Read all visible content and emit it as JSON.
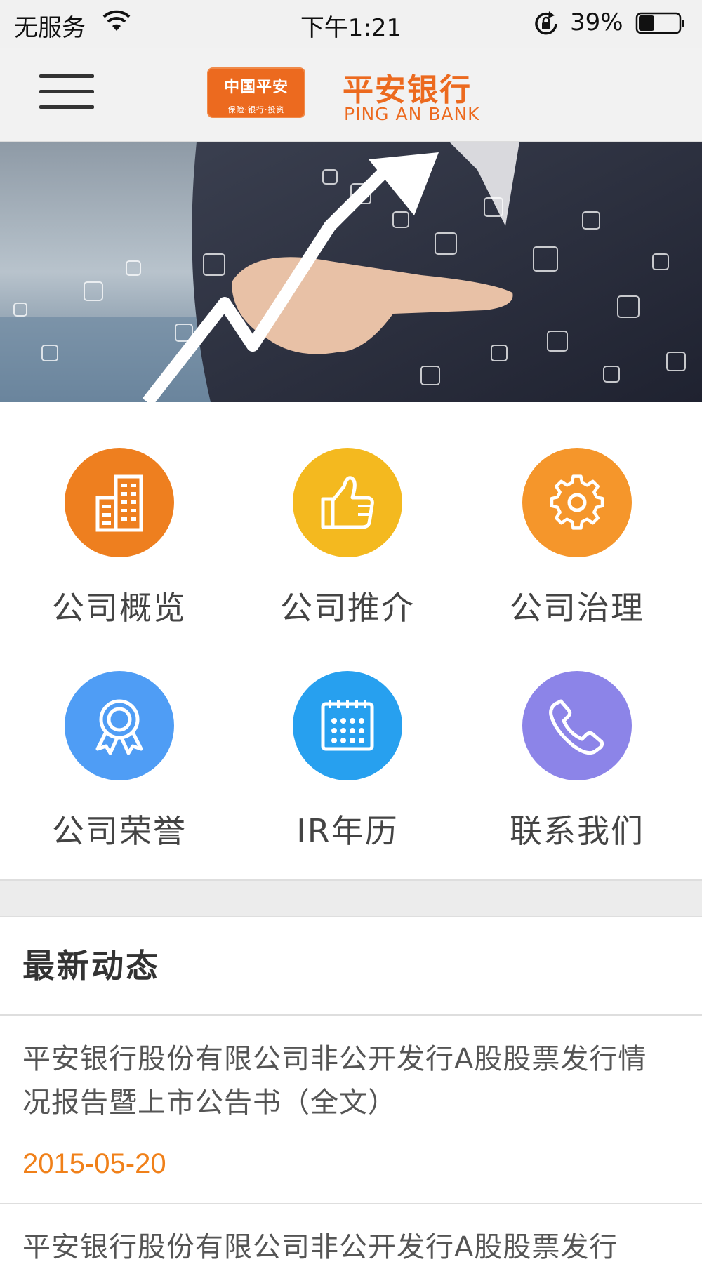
{
  "status_bar": {
    "carrier": "无服务",
    "time": "下午1:21",
    "battery_percent": "39%",
    "battery_level": 0.39
  },
  "nav": {
    "menu_icon": "hamburger-menu-icon",
    "logo": {
      "badge_main": "中国平安",
      "badge_sub": "保险·银行·投资",
      "name_cn": "平安银行",
      "name_en": "PING AN BANK"
    },
    "brand_color": "#ec6a1f"
  },
  "grid": {
    "items": [
      {
        "label": "公司概览",
        "icon": "building-icon",
        "color": "#ee7f1f"
      },
      {
        "label": "公司推介",
        "icon": "thumbs-up-icon",
        "color": "#f4b91f"
      },
      {
        "label": "公司治理",
        "icon": "gear-icon",
        "color": "#f5962b"
      },
      {
        "label": "公司荣誉",
        "icon": "award-ribbon-icon",
        "color": "#4f9df5"
      },
      {
        "label": "IR年历",
        "icon": "calendar-icon",
        "color": "#27a0ef"
      },
      {
        "label": "联系我们",
        "icon": "phone-icon",
        "color": "#8c84e8"
      }
    ]
  },
  "news": {
    "header": "最新动态",
    "items": [
      {
        "title": "平安银行股份有限公司非公开发行A股股票发行情况报告暨上市公告书（全文）",
        "date": "2015-05-20"
      },
      {
        "title": "平安银行股份有限公司非公开发行A股股票发行",
        "date": ""
      }
    ]
  }
}
